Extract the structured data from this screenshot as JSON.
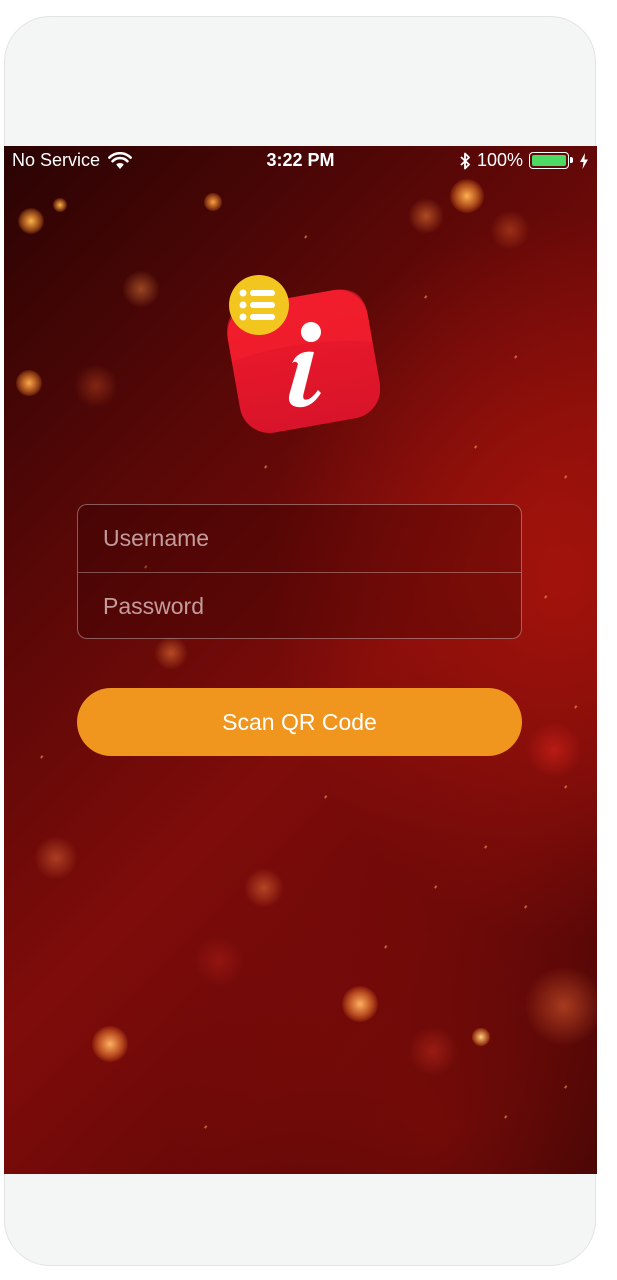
{
  "status_bar": {
    "carrier": "No Service",
    "time": "3:22 PM",
    "battery_percent": "100%",
    "battery_level": 1.0,
    "icons": [
      "wifi-icon",
      "bluetooth-icon",
      "battery-icon",
      "charging-icon"
    ]
  },
  "logo": {
    "icon": "info-list-app-logo-icon"
  },
  "form": {
    "username_placeholder": "Username",
    "password_placeholder": "Password"
  },
  "actions": {
    "scan_label": "Scan QR Code"
  },
  "colors": {
    "background": "#7e0c0a",
    "button": "#f0961f",
    "logo_red": "#e8192c",
    "logo_badge": "#f2c51f",
    "battery": "#4cd964"
  }
}
